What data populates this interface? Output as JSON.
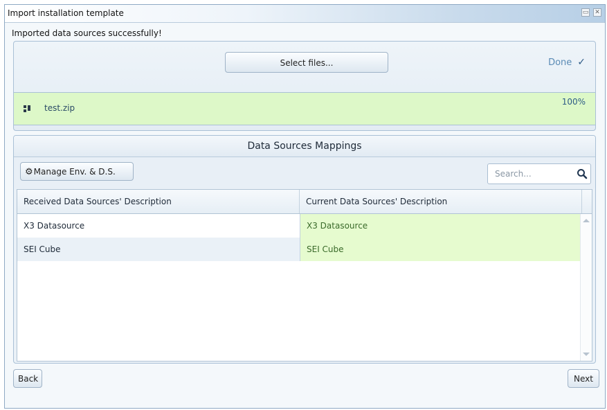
{
  "window": {
    "title": "Import installation template",
    "restore_icon": "restore-window-icon",
    "close_icon": "close-window-icon"
  },
  "status_message": "Imported data sources successfully!",
  "upload": {
    "select_files_label": "Select files...",
    "done_label": "Done",
    "done_icon": "checkmark-icon",
    "file": {
      "icon": "zip-file-icon",
      "name": "test.zip",
      "progress": "100%"
    },
    "file_row_color": "#ddf8c8"
  },
  "mappings": {
    "title": "Data Sources Mappings",
    "manage_button_label": "Manage Env. & D.S.",
    "manage_icon": "gear-icon",
    "search": {
      "placeholder": "Search...",
      "value": "",
      "icon": "search-icon"
    },
    "columns": [
      "Received Data Sources' Description",
      "Current Data Sources' Description"
    ],
    "rows": [
      {
        "received": "X3 Datasource",
        "current": "X3 Datasource"
      },
      {
        "received": "SEI Cube",
        "current": "SEI Cube"
      }
    ],
    "matched_cell_color": "#e6fbcf"
  },
  "footer": {
    "back_label": "Back",
    "next_label": "Next"
  }
}
